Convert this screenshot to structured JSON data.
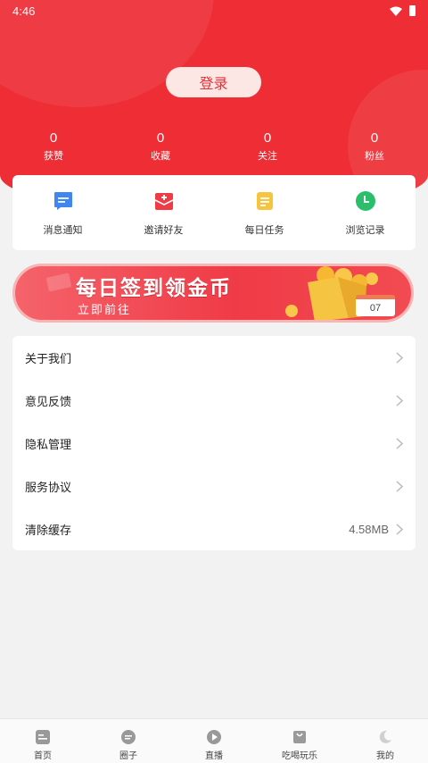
{
  "status_bar": {
    "time": "4:46"
  },
  "header": {
    "login_label": "登录"
  },
  "stats": [
    {
      "value": "0",
      "label": "获赞"
    },
    {
      "value": "0",
      "label": "收藏"
    },
    {
      "value": "0",
      "label": "关注"
    },
    {
      "value": "0",
      "label": "粉丝"
    }
  ],
  "quick_actions": [
    {
      "label": "消息通知",
      "icon": "message-icon",
      "color": "#3f86f2"
    },
    {
      "label": "邀请好友",
      "icon": "invite-envelope-icon",
      "color": "#ee3b45"
    },
    {
      "label": "每日任务",
      "icon": "task-note-icon",
      "color": "#f7c440"
    },
    {
      "label": "浏览记录",
      "icon": "clock-icon",
      "color": "#2bbf6b"
    }
  ],
  "banner": {
    "title": "每日签到领金币",
    "subtitle": "立即前往",
    "calendar_day": "07"
  },
  "menu": [
    {
      "label": "关于我们",
      "value": ""
    },
    {
      "label": "意见反馈",
      "value": ""
    },
    {
      "label": "隐私管理",
      "value": ""
    },
    {
      "label": "服务协议",
      "value": ""
    },
    {
      "label": "清除缓存",
      "value": "4.58MB"
    }
  ],
  "tabs": [
    {
      "label": "首页",
      "icon": "home-icon"
    },
    {
      "label": "圈子",
      "icon": "circle-chat-icon"
    },
    {
      "label": "直播",
      "icon": "play-icon"
    },
    {
      "label": "吃喝玩乐",
      "icon": "bag-icon"
    },
    {
      "label": "我的",
      "icon": "profile-icon"
    }
  ],
  "colors": {
    "brand_red": "#ee2d35",
    "background": "#f2f2f2"
  }
}
